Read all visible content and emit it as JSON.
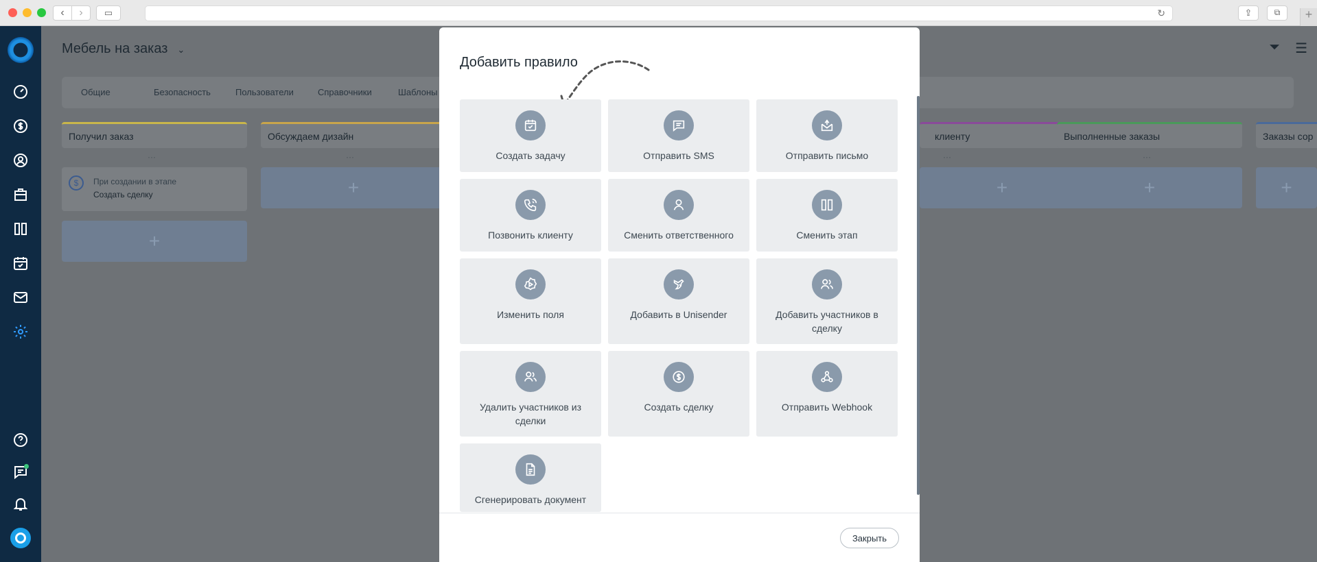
{
  "app": {
    "board_title": "Мебель на заказ"
  },
  "settings_tabs": [
    "Общие",
    "Безопасность",
    "Пользователи",
    "Справочники",
    "Шаблоны"
  ],
  "columns": [
    {
      "title": "Получил заказ",
      "color": "#c9b64a"
    },
    {
      "title": "Обсуждаем дизайн",
      "color": "#c9a54a"
    },
    {
      "title": "клиенту",
      "color": "#8a4a9a"
    },
    {
      "title": "Выполненные заказы",
      "color": "#4a9a5a"
    },
    {
      "title": "Заказы сор",
      "color": "#4a6a9a"
    }
  ],
  "column_dots": "···",
  "add_symbol": "+",
  "trigger": {
    "line1": "При создании в этапе",
    "line2": "Создать сделку"
  },
  "modal": {
    "title": "Добавить правило",
    "close_label": "Закрыть",
    "actions": [
      {
        "label": "Создать задачу",
        "icon": "calendar-check-icon"
      },
      {
        "label": "Отправить SMS",
        "icon": "sms-message-icon"
      },
      {
        "label": "Отправить письмо",
        "icon": "mail-open-icon"
      },
      {
        "label": "Позвонить клиенту",
        "icon": "phone-call-icon"
      },
      {
        "label": "Сменить ответственного",
        "icon": "user-icon"
      },
      {
        "label": "Сменить этап",
        "icon": "columns-icon"
      },
      {
        "label": "Изменить поля",
        "icon": "settings-play-icon"
      },
      {
        "label": "Добавить в Unisender",
        "icon": "unisender-bird-icon"
      },
      {
        "label": "Добавить участников в сделку",
        "icon": "users-add-icon"
      },
      {
        "label": "Удалить участников из сделки",
        "icon": "users-remove-icon"
      },
      {
        "label": "Создать сделку",
        "icon": "dollar-circle-icon"
      },
      {
        "label": "Отправить Webhook",
        "icon": "webhook-icon"
      },
      {
        "label": "Сгенерировать документ",
        "icon": "document-icon"
      }
    ]
  }
}
